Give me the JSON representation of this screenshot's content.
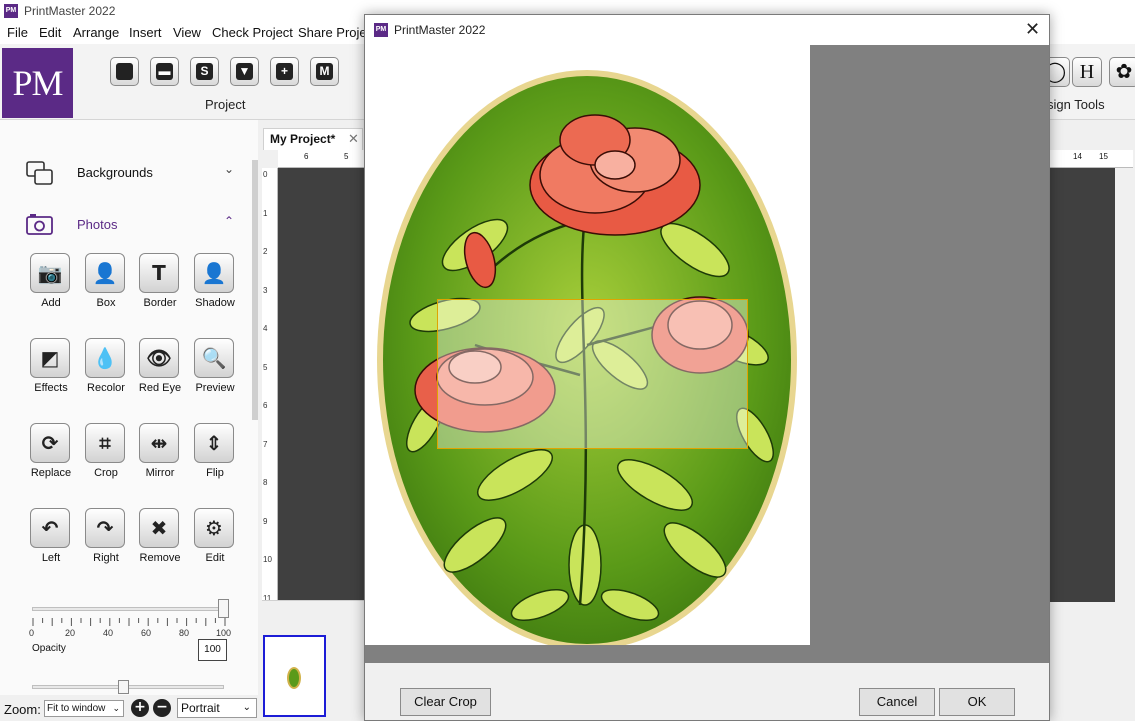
{
  "app": {
    "title": "PrintMaster 2022",
    "icon_text": "PM",
    "logo_text": "PM"
  },
  "menu": [
    "File",
    "Edit",
    "Arrange",
    "Insert",
    "View",
    "Check Project",
    "Share Projec"
  ],
  "ribbon": {
    "project_group_label": "Project",
    "design_tools_label": "sign Tools",
    "project_buttons": [
      "new-icon",
      "open-icon",
      "save-icon",
      "save-as-icon",
      "add-page-icon",
      "print-icon"
    ],
    "right_buttons": [
      "circle-tool-icon",
      "heading-tool-icon",
      "flower-tool-icon"
    ]
  },
  "left_panel": {
    "sections": [
      {
        "label": "Backgrounds",
        "icon": "backgrounds-icon",
        "chevron": "⌄",
        "expanded": false
      },
      {
        "label": "Photos",
        "icon": "photos-icon",
        "chevron": "⌃",
        "expanded": true
      }
    ],
    "tools": [
      {
        "label": "Add",
        "icon": "camera-icon",
        "glyph": "📷"
      },
      {
        "label": "Box",
        "icon": "box-photo-icon",
        "glyph": "👤"
      },
      {
        "label": "Border",
        "icon": "border-icon",
        "glyph": "T"
      },
      {
        "label": "Shadow",
        "icon": "shadow-icon",
        "glyph": "👤"
      },
      {
        "label": "Effects",
        "icon": "effects-icon",
        "glyph": "◩"
      },
      {
        "label": "Recolor",
        "icon": "recolor-icon",
        "glyph": "💧"
      },
      {
        "label": "Red Eye",
        "icon": "red-eye-icon",
        "glyph": "👁"
      },
      {
        "label": "Preview",
        "icon": "preview-icon",
        "glyph": "🔍"
      },
      {
        "label": "Replace",
        "icon": "replace-icon",
        "glyph": "⟳"
      },
      {
        "label": "Crop",
        "icon": "crop-icon",
        "glyph": "⌗"
      },
      {
        "label": "Mirror",
        "icon": "mirror-icon",
        "glyph": "⇹"
      },
      {
        "label": "Flip",
        "icon": "flip-icon",
        "glyph": "⇕"
      },
      {
        "label": "Left",
        "icon": "rotate-left-icon",
        "glyph": "↶"
      },
      {
        "label": "Right",
        "icon": "rotate-right-icon",
        "glyph": "↷"
      },
      {
        "label": "Remove",
        "icon": "remove-icon",
        "glyph": "✖"
      },
      {
        "label": "Edit",
        "icon": "edit-icon",
        "glyph": "⚙"
      }
    ],
    "opacity": {
      "label": "Opacity",
      "value": "100",
      "scale": [
        "0",
        "20",
        "40",
        "60",
        "80",
        "100"
      ],
      "level": 1.0
    },
    "second_slider_level": 0.48
  },
  "zoom": {
    "label": "Zoom:",
    "value": "Fit to window",
    "zoom_in": "+",
    "zoom_out": "−",
    "orientation": "Portrait"
  },
  "workspace": {
    "tab_label": "My Project*",
    "tab_close": "✕",
    "ruler_top": [
      "6",
      "5"
    ],
    "ruler_right": [
      "14",
      "15"
    ],
    "ruler_left": [
      "0",
      "1",
      "2",
      "3",
      "4",
      "5",
      "6",
      "7",
      "8",
      "9",
      "10",
      "11"
    ]
  },
  "dialog": {
    "title": "PrintMaster 2022",
    "icon_text": "PM",
    "close": "✕",
    "clear_crop": "Clear Crop",
    "cancel": "Cancel",
    "ok": "OK"
  },
  "colors": {
    "brand_purple": "#5b2a86",
    "leaf_green": "#4f8f14",
    "rose_red": "#e8503a",
    "crop_border": "#e0a400",
    "thumbnail_border": "#1c1cd6"
  }
}
